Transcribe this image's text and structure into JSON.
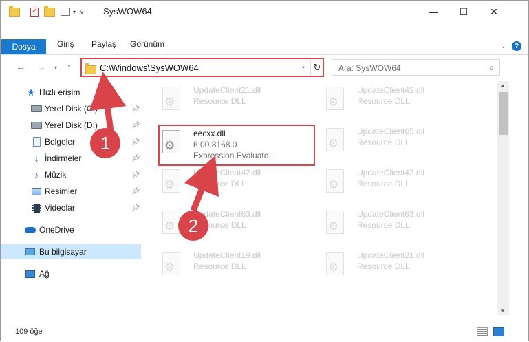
{
  "window": {
    "title": "SysWOW64",
    "controls": {
      "minimize": "—",
      "maximize": "☐",
      "close": "✕"
    }
  },
  "ribbon": {
    "tabs": [
      "Dosya",
      "Giriş",
      "Paylaş",
      "Görünüm"
    ]
  },
  "address": {
    "path": "C:\\Windows\\SysWOW64",
    "search_placeholder": "Ara: SysWOW64"
  },
  "sidebar": {
    "items": [
      {
        "label": "Hızlı erişim",
        "icon": "star-icon"
      },
      {
        "label": "Yerel Disk (C:)",
        "icon": "drive-icon",
        "pinned": true
      },
      {
        "label": "Yerel Disk (D:)",
        "icon": "drive-icon",
        "pinned": true
      },
      {
        "label": "Belgeler",
        "icon": "document-icon",
        "pinned": true
      },
      {
        "label": "İndirmeler",
        "icon": "download-icon",
        "pinned": true
      },
      {
        "label": "Müzik",
        "icon": "music-icon",
        "pinned": true
      },
      {
        "label": "Resimler",
        "icon": "pictures-icon",
        "pinned": true
      },
      {
        "label": "Videolar",
        "icon": "videos-icon",
        "pinned": true
      },
      {
        "label": "OneDrive",
        "icon": "cloud-icon"
      },
      {
        "label": "Bu bilgisayar",
        "icon": "computer-icon",
        "selected": true
      },
      {
        "label": "Ağ",
        "icon": "network-icon"
      }
    ]
  },
  "files": {
    "left": [
      {
        "name": "UpdateClient21.dll",
        "sub": "Resource DLL"
      },
      {
        "name": "eecxx.dll",
        "sub": "6.00.8168.0",
        "line3": "Expression Evaluato...",
        "highlighted": true
      },
      {
        "name": "UpdateClient42.dll",
        "sub": "Resource DLL"
      },
      {
        "name": "UpdateClient63.dll",
        "sub": "Resource DLL"
      },
      {
        "name": "UpdateClient19.dll",
        "sub": "Resource DLL"
      }
    ],
    "right": [
      {
        "name": "UpdateClient42.dll",
        "sub": "Resource DLL"
      },
      {
        "name": "UpdateClient65.dll",
        "sub": "Resource DLL"
      },
      {
        "name": "UpdateClient42.dll",
        "sub": "Resource DLL"
      },
      {
        "name": "UpdateClient63.dll",
        "sub": "Resource DLL"
      },
      {
        "name": "UpdateClient21.dll",
        "sub": "Resource DLL"
      }
    ]
  },
  "status": {
    "count": "109 öğe"
  },
  "annotations": {
    "step1": "1",
    "step2": "2",
    "color": "#d9444b"
  }
}
